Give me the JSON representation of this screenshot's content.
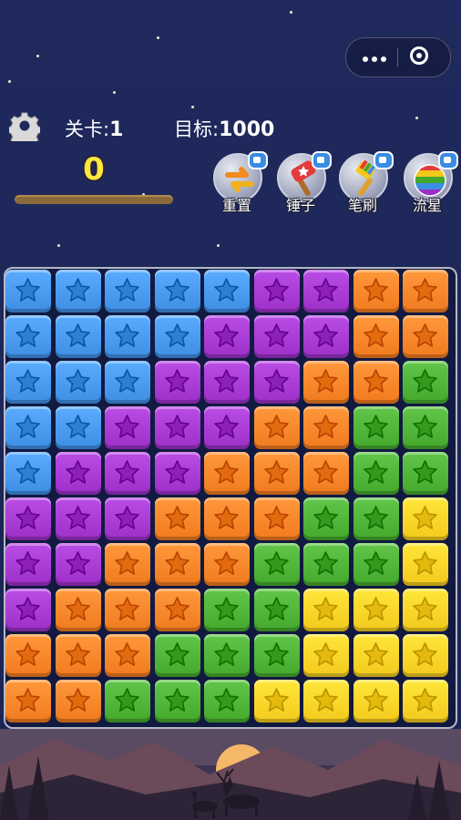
{
  "header": {
    "level_label": "关卡:",
    "level_value": "1",
    "goal_label": "目标:",
    "goal_value": "1000",
    "score": "0",
    "score_progress": 0.0
  },
  "capsule": {
    "more_icon": "more-dots-icon",
    "close_icon": "target-circle-icon"
  },
  "settings": {
    "icon": "gear-icon"
  },
  "tools": [
    {
      "label": "重置",
      "icon": "swap-arrows-icon",
      "badge_icon": "video-camera-icon"
    },
    {
      "label": "锤子",
      "icon": "hammer-icon",
      "badge_icon": "video-camera-icon"
    },
    {
      "label": "笔刷",
      "icon": "paintbrush-icon",
      "badge_icon": "video-camera-icon"
    },
    {
      "label": "流星",
      "icon": "rainbow-ball-icon",
      "badge_icon": "video-camera-icon"
    }
  ],
  "colors": {
    "B": "#3d8ee3",
    "P": "#9c2fc7",
    "O": "#f07a1e",
    "G": "#44a82c",
    "Y": "#f2c91c"
  },
  "board": {
    "rows": [
      "BBBBBPPOO",
      "BBBBPPPOO",
      "BBBPPPOOG",
      "BBPPPOOGG",
      "BPPPOOOGG",
      "PPPOOOGGY",
      "PPOOOGGGY",
      "POOOGGYYY",
      "OOOGGGYYY",
      "OOGGGYYYY"
    ]
  }
}
